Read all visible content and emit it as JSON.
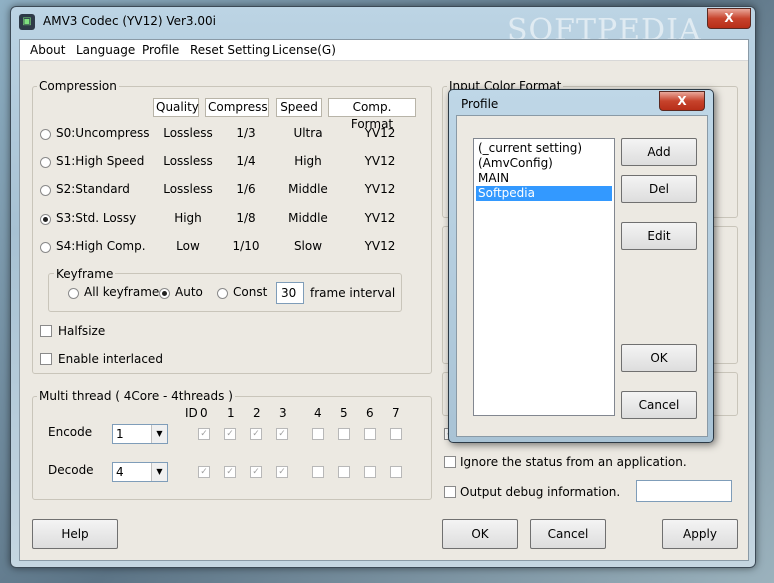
{
  "window": {
    "title": "AMV3 Codec (YV12) Ver3.00i",
    "close": "X",
    "watermark": "SOFTPEDIA"
  },
  "menu": [
    "About",
    "Language",
    "Profile",
    "Reset Setting",
    "License(G)"
  ],
  "compression": {
    "title": "Compression",
    "headers": [
      "Quality",
      "Compress",
      "Speed",
      "Comp. Format"
    ],
    "rows": [
      {
        "label": "S0:Uncompress",
        "quality": "Lossless",
        "compress": "1/3",
        "speed": "Ultra",
        "format": "YV12",
        "selected": false
      },
      {
        "label": "S1:High Speed",
        "quality": "Lossless",
        "compress": "1/4",
        "speed": "High",
        "format": "YV12",
        "selected": false
      },
      {
        "label": "S2:Standard",
        "quality": "Lossless",
        "compress": "1/6",
        "speed": "Middle",
        "format": "YV12",
        "selected": false
      },
      {
        "label": "S3:Std. Lossy",
        "quality": "High",
        "compress": "1/8",
        "speed": "Middle",
        "format": "YV12",
        "selected": true
      },
      {
        "label": "S4:High Comp.",
        "quality": "Low",
        "compress": "1/10",
        "speed": "Slow",
        "format": "YV12",
        "selected": false
      }
    ],
    "keyframe": {
      "title": "Keyframe",
      "all": "All keyframe",
      "auto": "Auto",
      "const": "Const",
      "value": "30",
      "suffix": "frame interval"
    },
    "halfsize": "Halfsize",
    "interlaced": "Enable interlaced"
  },
  "multithread": {
    "title": "Multi thread ( 4Core - 4threads )",
    "id_label": "ID",
    "ids": [
      "0",
      "1",
      "2",
      "3",
      "4",
      "5",
      "6",
      "7"
    ],
    "encode_label": "Encode",
    "encode_value": "1",
    "decode_label": "Decode",
    "decode_value": "4"
  },
  "right": {
    "input_color_format": "Input Color Format",
    "ignore_status": "Ignore the status from an application.",
    "output_debug": "Output debug information."
  },
  "buttons": {
    "help": "Help",
    "ok": "OK",
    "cancel": "Cancel",
    "apply": "Apply"
  },
  "profile": {
    "title": "Profile",
    "close": "X",
    "items": [
      "(_current setting)",
      "(AmvConfig)",
      "MAIN",
      "Softpedia"
    ],
    "selected_index": 3,
    "add": "Add",
    "del": "Del",
    "edit": "Edit",
    "ok": "OK",
    "cancel": "Cancel"
  }
}
